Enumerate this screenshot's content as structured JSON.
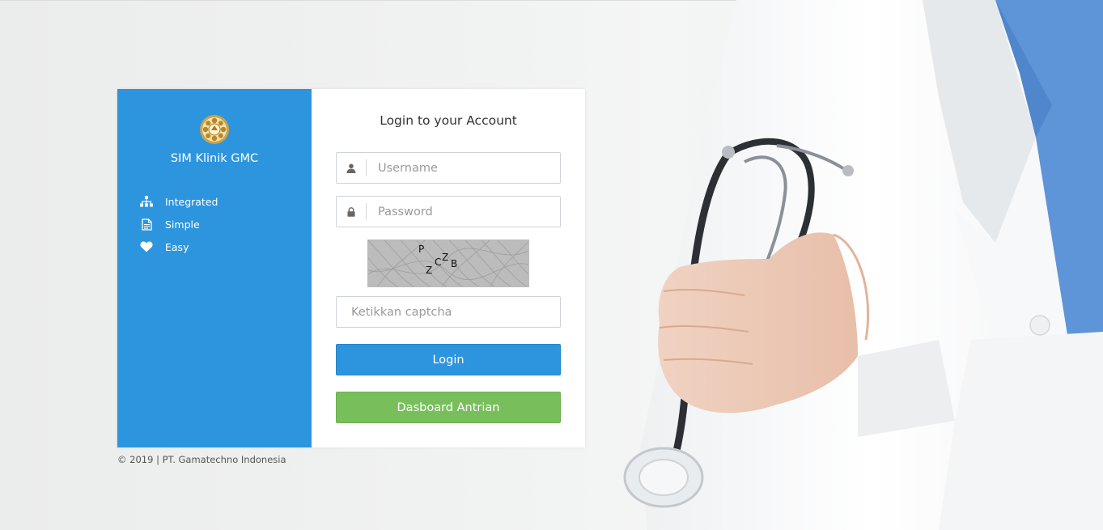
{
  "brand": {
    "name": "SIM Klinik GMC",
    "logo_icon": "university-seal-icon"
  },
  "features": [
    {
      "icon": "sitemap-icon",
      "label": "Integrated"
    },
    {
      "icon": "document-icon",
      "label": "Simple"
    },
    {
      "icon": "heart-icon",
      "label": "Easy"
    }
  ],
  "login": {
    "title": "Login to your Account",
    "username": {
      "placeholder": "Username",
      "value": "",
      "icon": "user-icon"
    },
    "password": {
      "placeholder": "Password",
      "value": "",
      "icon": "lock-icon"
    },
    "captcha": {
      "text": "PZCZB"
    },
    "captcha_input": {
      "placeholder": "Ketikkan captcha",
      "value": ""
    },
    "login_button": "Login",
    "queue_button": "Dasboard Antrian"
  },
  "footer": {
    "text": "© 2019 | PT. Gamatechno Indonesia"
  },
  "colors": {
    "primary": "#2d95dd",
    "success": "#78bf5c",
    "panel": "#ffffff"
  }
}
